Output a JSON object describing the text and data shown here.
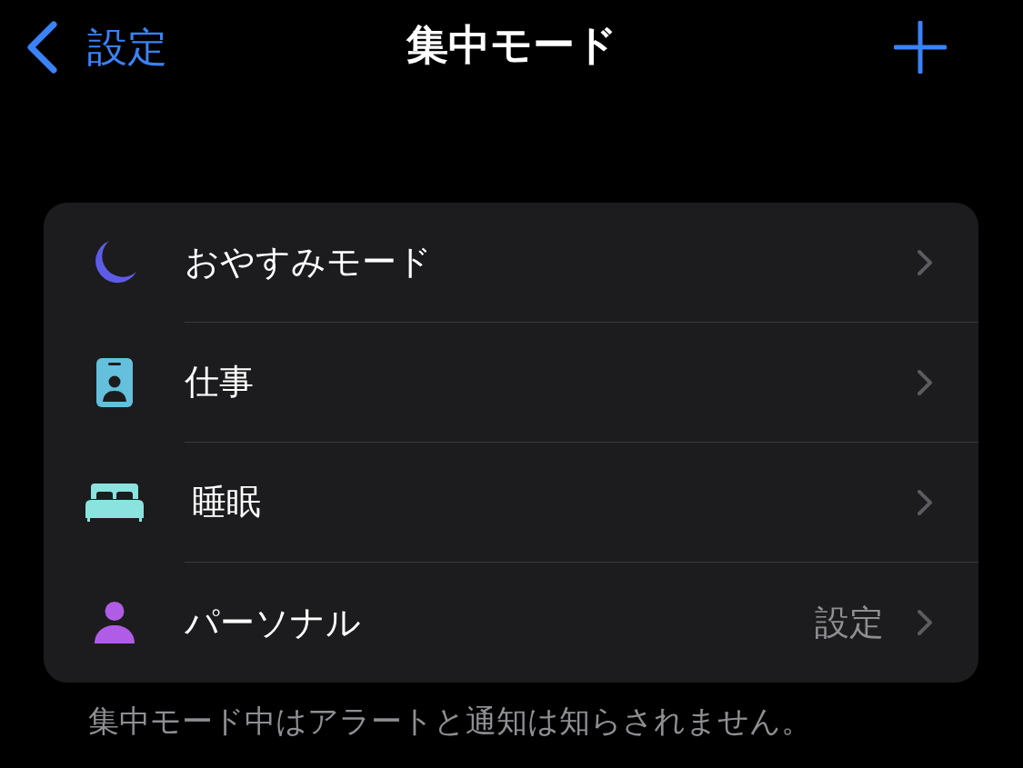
{
  "nav_bar": {
    "back_label": "設定",
    "title": "集中モード"
  },
  "focus_modes": [
    {
      "name": "おやすみモード",
      "kind": "dnd",
      "color": "#5e5ce6"
    },
    {
      "name": "仕事",
      "kind": "work",
      "color": "#64c0dc"
    },
    {
      "name": "睡眠",
      "kind": "sleep",
      "color": "#8ae3df"
    },
    {
      "name": "パーソナル",
      "kind": "personal",
      "color": "#b15ce6",
      "detail": "設定"
    }
  ],
  "footer": "集中モード中はアラートと通知は知らされません。"
}
